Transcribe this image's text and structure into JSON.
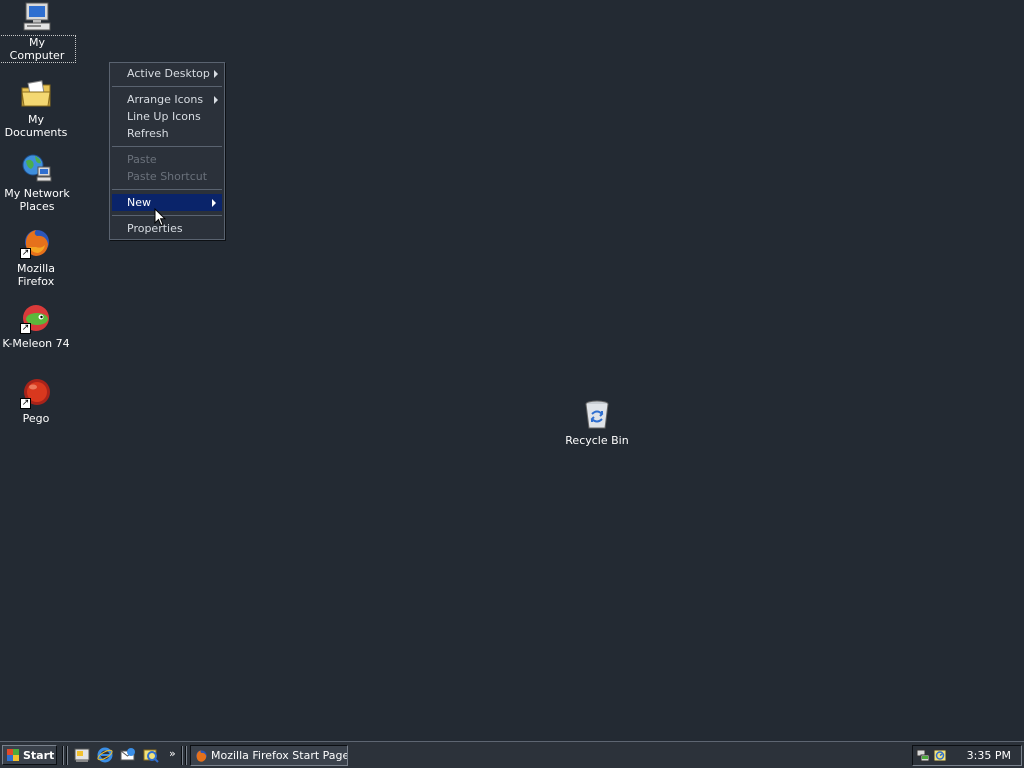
{
  "desktop": {
    "icons": [
      {
        "label": "My Computer",
        "icon": "my-computer-icon"
      },
      {
        "label": "My Documents",
        "icon": "my-documents-icon"
      },
      {
        "label_line1": "My Network",
        "label_line2": "Places",
        "icon": "my-network-places-icon"
      },
      {
        "label": "Mozilla Firefox",
        "icon": "firefox-icon"
      },
      {
        "label": "K-Meleon 74",
        "icon": "k-meleon-icon"
      },
      {
        "label": "Pego",
        "icon": "pego-icon"
      },
      {
        "label": "Recycle Bin",
        "icon": "recycle-bin-icon"
      }
    ]
  },
  "context_menu": {
    "items": [
      {
        "label": "Active Desktop",
        "submenu": true,
        "enabled": true
      },
      {
        "label": "Arrange Icons",
        "submenu": true,
        "enabled": true
      },
      {
        "label": "Line Up Icons",
        "enabled": true
      },
      {
        "label": "Refresh",
        "enabled": true
      },
      {
        "label": "Paste",
        "enabled": false
      },
      {
        "label": "Paste Shortcut",
        "enabled": false
      },
      {
        "label": "New",
        "submenu": true,
        "enabled": true,
        "highlighted": true
      },
      {
        "label": "Properties",
        "enabled": true
      }
    ]
  },
  "taskbar": {
    "start_label": "Start",
    "quick_launch": [
      "show-desktop-icon",
      "internet-explorer-icon",
      "outlook-express-icon",
      "media-icon"
    ],
    "quick_launch_more": "»",
    "task_button_label": "Mozilla Firefox Start Page...",
    "tray_icons": [
      "network-tray-icon",
      "security-tray-icon"
    ],
    "clock": "3:35 PM"
  },
  "colors": {
    "desktop_background": "#232a33",
    "menu_highlight": "#0a246a"
  }
}
